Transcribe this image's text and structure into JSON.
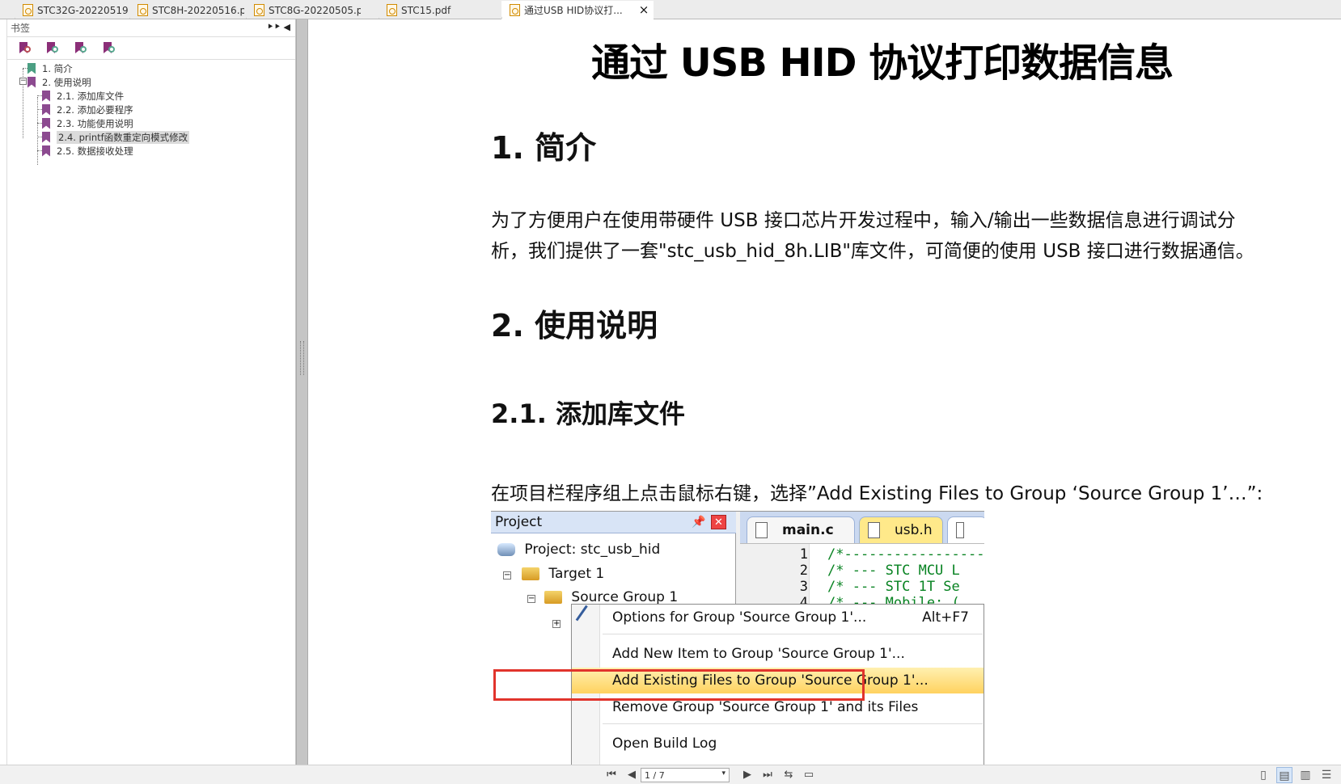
{
  "tabs": [
    {
      "label": "STC32G-20220519...."
    },
    {
      "label": "STC8H-20220516.p..."
    },
    {
      "label": "STC8G-20220505.p..."
    },
    {
      "label": "STC15.pdf"
    },
    {
      "label": "通过USB HID协议打..."
    }
  ],
  "tab_close": "×",
  "sidebar": {
    "title": "书签",
    "controls": "⯈⯈ ◀",
    "toolbar": [
      {
        "icon": "bookmark-add-icon"
      },
      {
        "icon": "bookmark-expand-icon"
      },
      {
        "icon": "bookmark-arrow-icon"
      },
      {
        "icon": "bookmark-search-icon"
      }
    ],
    "items": [
      {
        "label": "1. 简介"
      },
      {
        "label": "2. 使用说明"
      },
      {
        "label": "2.1. 添加库文件"
      },
      {
        "label": "2.2. 添加必要程序"
      },
      {
        "label": "2.3. 功能使用说明"
      },
      {
        "label": "2.4. printf函数重定向模式修改"
      },
      {
        "label": "2.5. 数据接收处理"
      }
    ]
  },
  "document": {
    "title": "通过 USB HID 协议打印数据信息",
    "h1": "1.  简介",
    "p1": "为了方便用户在使用带硬件 USB 接口芯片开发过程中，输入/输出一些数据信息进行调试分",
    "p2": "析，我们提供了一套\"stc_usb_hid_8h.LIB\"库文件，可简便的使用 USB 接口进行数据通信。",
    "h2": "2.  使用说明",
    "h21": "2.1.  添加库文件",
    "p3": "在项目栏程序组上点击鼠标右键，选择”Add Existing Files to Group ‘Source Group 1’…”:"
  },
  "embedded_ide": {
    "project_title": "Project",
    "project_root": "Project: stc_usb_hid",
    "target": "Target 1",
    "group": "Source Group 1",
    "tabs": {
      "main": "main.c",
      "usb": "usb.h"
    },
    "lines": [
      {
        "num": "1",
        "text": "/*-------------------"
      },
      {
        "num": "2",
        "text": "/* --- STC MCU L"
      },
      {
        "num": "3",
        "text": "/* --- STC 1T Se"
      },
      {
        "num": "4",
        "text": "/* --- Mobile: ("
      }
    ],
    "menu": [
      {
        "label": "Options for Group 'Source Group 1'...",
        "shortcut": "Alt+F7"
      },
      {
        "label": "Add New  Item to Group 'Source Group 1'...",
        "shortcut": ""
      },
      {
        "label": "Add Existing Files to Group 'Source Group 1'...",
        "shortcut": ""
      },
      {
        "label": "Remove Group 'Source Group 1' and its Files",
        "shortcut": ""
      },
      {
        "label": "Open Build Log",
        "shortcut": ""
      }
    ]
  },
  "statusbar": {
    "page": "1 / 7",
    "buttons": [
      "first-page-icon",
      "previous-page-icon",
      "next-page-icon",
      "last-page-icon",
      "fit-width-icon",
      "fit-page-icon"
    ],
    "views": [
      "single-page-view-icon",
      "continuous-view-icon",
      "two-page-view-icon",
      "book-view-icon"
    ]
  },
  "colors": {
    "bookmark": "#8c4a90",
    "highlight": "#ffd25f",
    "outline": "#e1342c"
  }
}
